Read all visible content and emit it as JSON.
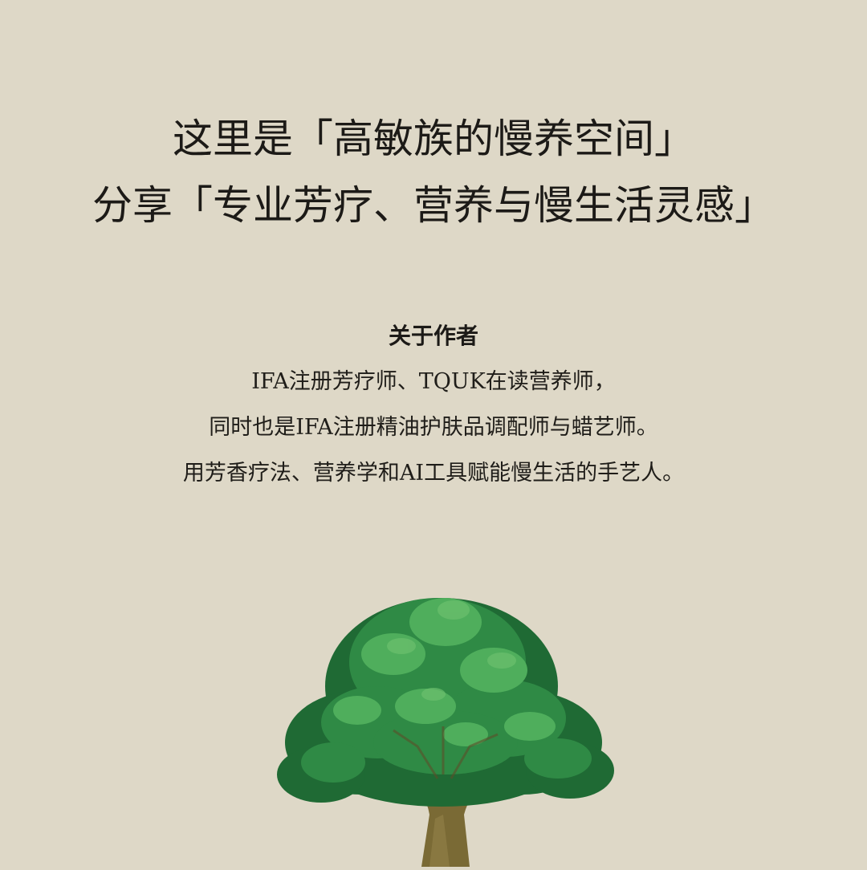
{
  "headline": {
    "line1": "这里是「高敏族的慢养空间」",
    "line2": "分享「专业芳疗、营养与慢生活灵感」"
  },
  "about": {
    "title": "关于作者",
    "lines": [
      "IFA注册芳疗师、TQUK在读营养师，",
      "同时也是IFA注册精油护肤品调配师与蜡艺师。",
      "用芳香疗法、营养学和AI工具赋能慢生活的手艺人。"
    ]
  },
  "illustration": {
    "icon": "tree-icon",
    "colors": {
      "background": "#ded8c7",
      "foliage_dark": "#1f6a34",
      "foliage_mid": "#2f8a45",
      "foliage_light": "#4fae5c",
      "trunk": "#7a6a35"
    }
  }
}
